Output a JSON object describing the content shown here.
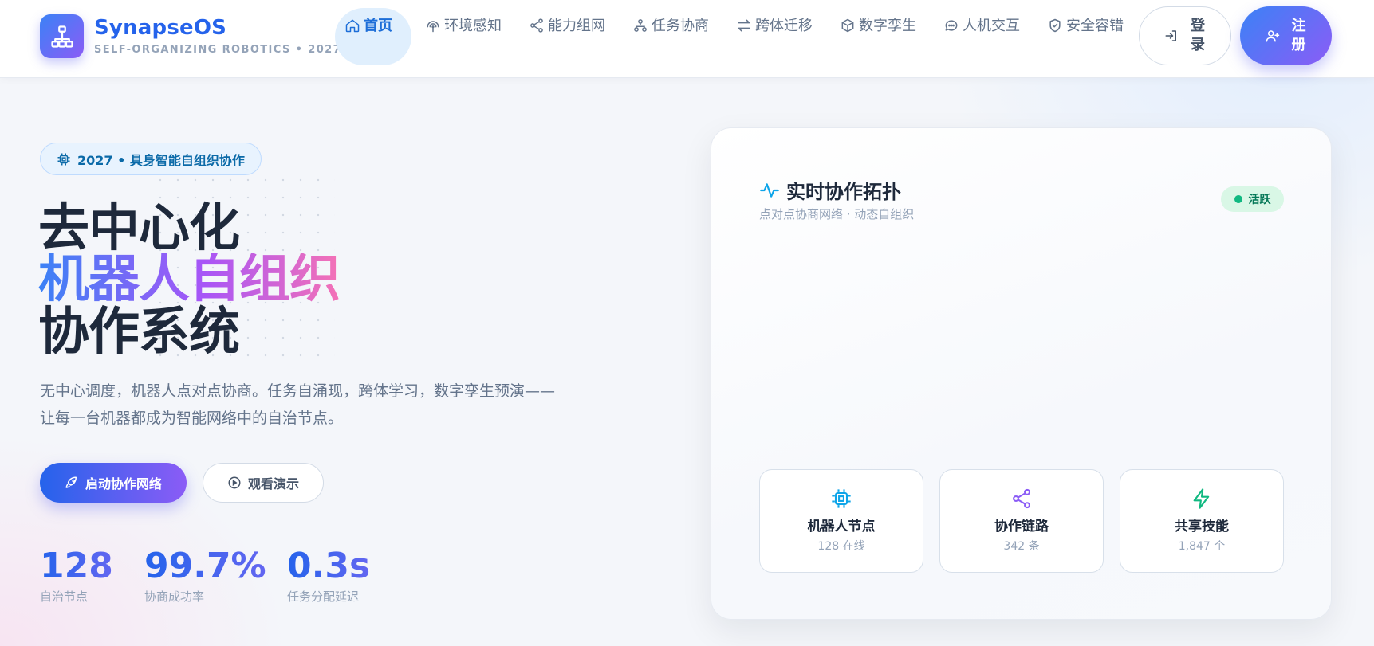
{
  "brand": {
    "name": "SynapseOS",
    "tagline": "SELF-ORGANIZING ROBOTICS • 2027",
    "logo_icon": "network-icon"
  },
  "nav": {
    "items": [
      {
        "label": "首页",
        "icon": "home-icon",
        "active": true
      },
      {
        "label": "环境感知",
        "icon": "radar-icon",
        "active": false
      },
      {
        "label": "能力组网",
        "icon": "share-icon",
        "active": false
      },
      {
        "label": "任务协商",
        "icon": "hierarchy-icon",
        "active": false
      },
      {
        "label": "跨体迁移",
        "icon": "transfer-icon",
        "active": false
      },
      {
        "label": "数字孪生",
        "icon": "cube-icon",
        "active": false
      },
      {
        "label": "人机交互",
        "icon": "chat-icon",
        "active": false
      },
      {
        "label": "安全容错",
        "icon": "shield-icon",
        "active": false
      }
    ],
    "login_label": "登录",
    "register_label": "注册"
  },
  "hero": {
    "badge": "2027 • 具身智能自组织协作",
    "title_line1": "去中心化",
    "title_line2": "机器人自组织",
    "title_line3": "协作系统",
    "description": "无中心调度，机器人点对点协商。任务自涌现，跨体学习，数字孪生预演——让每一台机器都成为智能网络中的自治节点。",
    "primary_cta": "启动协作网络",
    "secondary_cta": "观看演示",
    "stats": [
      {
        "value": "128",
        "label": "自治节点"
      },
      {
        "value": "99.7%",
        "label": "协商成功率"
      },
      {
        "value": "0.3s",
        "label": "任务分配延迟"
      }
    ]
  },
  "topology": {
    "title": "实时协作拓扑",
    "subtitle": "点对点协商网络 · 动态自组织",
    "status": "活跃",
    "status_color": "#10b981",
    "cards": [
      {
        "title": "机器人节点",
        "value": "128 在线",
        "icon": "chip-icon",
        "color": "#0ea5e9"
      },
      {
        "title": "协作链路",
        "value": "342 条",
        "icon": "share-icon",
        "color": "#8b5cf6"
      },
      {
        "title": "共享技能",
        "value": "1,847 个",
        "icon": "bolt-icon",
        "color": "#10b981"
      }
    ]
  },
  "colors": {
    "accent": "#2563eb",
    "accent_purple": "#8b5cf6",
    "active_nav_bg": "#e0effd"
  }
}
